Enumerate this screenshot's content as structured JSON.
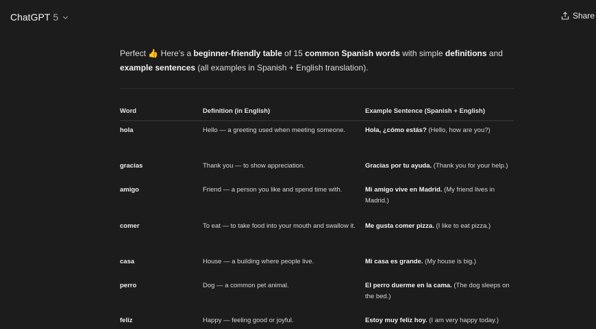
{
  "header": {
    "brand": "ChatGPT",
    "version": "5",
    "share_label": "Share"
  },
  "intro": {
    "p1": "Perfect ",
    "emoji": "👍",
    "p2": " Here’s a ",
    "b1": "beginner-friendly table",
    "p3": " of 15 ",
    "b2": "common Spanish words",
    "p4": " with simple ",
    "b3": "definitions",
    "p5": " and ",
    "b4": "example sentences",
    "p6": " (all examples in Spanish + English translation)."
  },
  "table": {
    "headers": [
      "Word",
      "Definition (in English)",
      "Example Sentence (Spanish + English)"
    ],
    "rows": [
      {
        "word": "hola",
        "definition": "Hello — a greeting used when meeting someone.",
        "example_es": "Hola, ¿cómo estás?",
        "example_en": " (Hello, how are you?)"
      },
      {
        "word": "gracias",
        "definition": "Thank you — to show appreciation.",
        "example_es": "Gracias por tu ayuda.",
        "example_en": " (Thank you for your help.)"
      },
      {
        "word": "amigo",
        "definition": "Friend — a person you like and spend time with.",
        "example_es": "Mi amigo vive en Madrid.",
        "example_en": " (My friend lives in Madrid.)"
      },
      {
        "word": "comer",
        "definition": "To eat — to take food into your mouth and swallow it.",
        "example_es": "Me gusta comer pizza.",
        "example_en": " (I like to eat pizza.)"
      },
      {
        "word": "casa",
        "definition": "House — a building where people live.",
        "example_es": "Mi casa es grande.",
        "example_en": " (My house is big.)"
      },
      {
        "word": "perro",
        "definition": "Dog — a common pet animal.",
        "example_es": "El perro duerme en la cama.",
        "example_en": " (The dog sleeps on the bed.)"
      },
      {
        "word": "feliz",
        "definition": "Happy — feeling good or joyful.",
        "example_es": "Estoy muy feliz hoy.",
        "example_en": " (I am very happy today.)"
      }
    ]
  }
}
